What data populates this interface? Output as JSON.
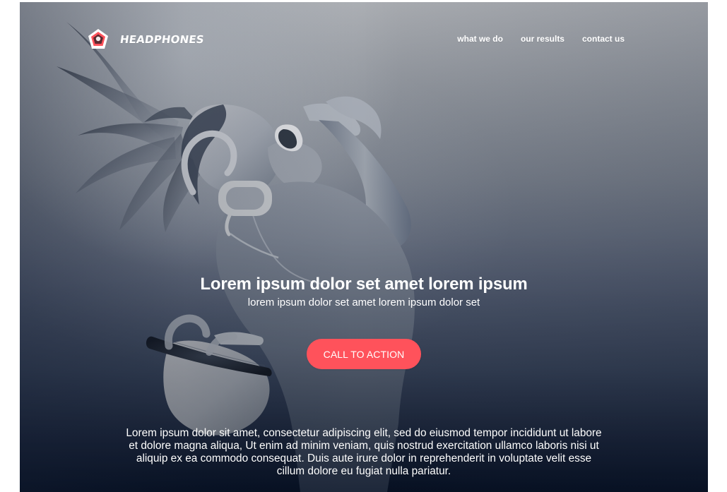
{
  "header": {
    "brand_name": "HEADPHONES",
    "brand_icon": "pentagon-logo-icon",
    "nav": [
      {
        "label": "what we do"
      },
      {
        "label": "our results"
      },
      {
        "label": "contact us"
      }
    ]
  },
  "hero": {
    "title": "Lorem ipsum dolor set amet lorem ipsum",
    "subtitle": "lorem ipsum dolor set amet lorem ipsum dolor set",
    "cta_label": "CALL TO ACTION"
  },
  "body": {
    "paragraph": "Lorem ipsum dolor sit amet, consectetur adipiscing elit, sed do eiusmod tempor incididunt ut labore et dolore magna aliqua, Ut enim ad minim veniam, quis nostrud exercitation ullamco laboris nisi ut aliquip ex ea commodo consequat. Duis aute irure dolor in reprehenderit in voluptate velit esse cillum dolore eu fugiat nulla pariatur."
  },
  "colors": {
    "accent": "#ff525b",
    "text": "#ffffff",
    "page_background": "#ffffff",
    "hero_dark": "#08152d"
  }
}
